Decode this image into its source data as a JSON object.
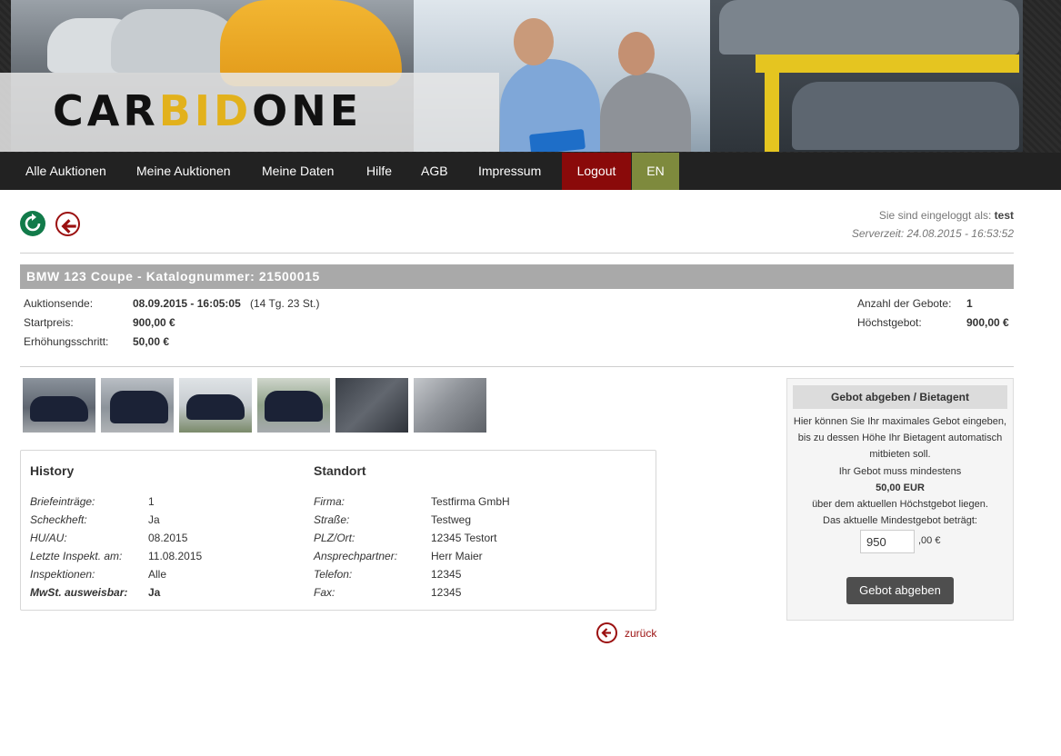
{
  "brand": {
    "logo_part1": "CAR",
    "logo_part2": "BID",
    "logo_part3": "ONE"
  },
  "nav": {
    "items": [
      "Alle Auktionen",
      "Meine Auktionen",
      "Meine Daten",
      "Hilfe",
      "AGB",
      "Impressum",
      "Logout",
      "EN"
    ]
  },
  "status": {
    "logged_in_prefix": "Sie sind eingeloggt als:",
    "username": "test",
    "server_time": "Serverzeit: 24.08.2015 - 16:53:52"
  },
  "auction": {
    "title": "BMW 123 Coupe - Katalognummer: 21500015",
    "end_label": "Auktionsende:",
    "end_value": "08.09.2015 - 16:05:05",
    "end_remaining": "(14 Tg. 23 St.)",
    "start_label": "Startpreis:",
    "start_value": "900,00 €",
    "step_label": "Erhöhungsschritt:",
    "step_value": "50,00 €",
    "bids_label": "Anzahl der Gebote:",
    "bids_value": "1",
    "highest_label": "Höchstgebot:",
    "highest_value": "900,00 €"
  },
  "thumbnails": [
    "photo-1",
    "photo-2",
    "photo-3",
    "photo-4",
    "photo-5",
    "photo-6"
  ],
  "history": {
    "title": "History",
    "rows": [
      {
        "label": "Briefeinträge:",
        "value": "1"
      },
      {
        "label": "Scheckheft:",
        "value": "Ja"
      },
      {
        "label": "HU/AU:",
        "value": "08.2015"
      },
      {
        "label": "Letzte Inspekt. am:",
        "value": "11.08.2015"
      },
      {
        "label": "Inspektionen:",
        "value": "Alle"
      },
      {
        "label": "MwSt. ausweisbar:",
        "value": "Ja"
      }
    ]
  },
  "location": {
    "title": "Standort",
    "rows": [
      {
        "label": "Firma:",
        "value": "Testfirma GmbH"
      },
      {
        "label": "Straße:",
        "value": "Testweg"
      },
      {
        "label": "PLZ/Ort:",
        "value": "12345 Testort"
      },
      {
        "label": "Ansprechpartner:",
        "value": "Herr Maier"
      },
      {
        "label": "Telefon:",
        "value": "12345"
      },
      {
        "label": "Fax:",
        "value": "12345"
      }
    ]
  },
  "back_link": "zurück",
  "bid": {
    "heading": "Gebot abgeben / Bietagent",
    "line1": "Hier können Sie Ihr maximales Gebot eingeben,",
    "line2": "bis zu dessen Höhe Ihr Bietagent automatisch",
    "line3": "mitbieten soll.",
    "line4": "Ihr Gebot muss mindestens",
    "line5": "50,00 EUR",
    "line6": "über dem aktuellen Höchstgebot liegen.",
    "line7": "Das aktuelle Mindestgebot beträgt:",
    "input_value": "950",
    "suffix": ",00 €",
    "button": "Gebot abgeben"
  },
  "colors": {
    "nav_bg": "#222222",
    "logout": "#8a0a0a",
    "lang": "#7e8a3d",
    "refresh": "#127b4a",
    "back": "#9b1010",
    "logo_accent": "#e2b11c"
  },
  "icons": [
    "refresh-icon",
    "back-arrow-icon"
  ]
}
